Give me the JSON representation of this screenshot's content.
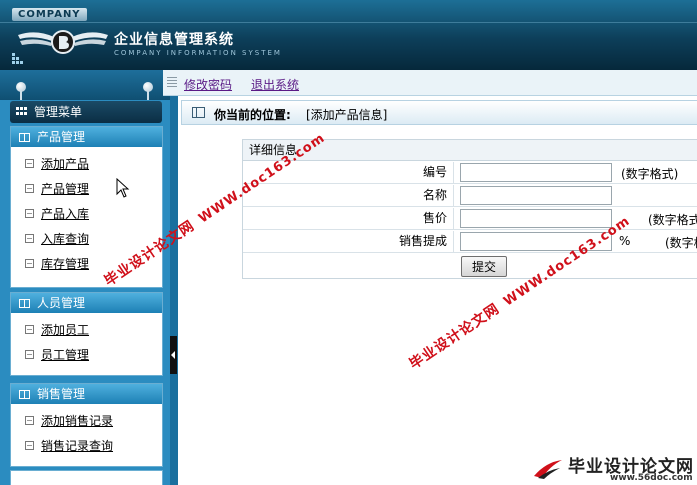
{
  "header": {
    "company_badge": "COMPANY",
    "title": "企业信息管理系统",
    "subtitle": "COMPANY INFORMATION SYSTEM"
  },
  "toolbar": {
    "change_password": "修改密码",
    "logout": "退出系统"
  },
  "sidebar": {
    "menu_title": "管理菜单",
    "panels": [
      {
        "title": "产品管理",
        "items": [
          "添加产品",
          "产品管理",
          "产品入库",
          "入库查询",
          "库存管理"
        ]
      },
      {
        "title": "人员管理",
        "items": [
          "添加员工",
          "员工管理"
        ]
      },
      {
        "title": "销售管理",
        "items": [
          "添加销售记录",
          "销售记录查询"
        ]
      }
    ]
  },
  "location": {
    "label": "你当前的位置:",
    "value": "[添加产品信息]"
  },
  "form": {
    "section_title": "详细信息",
    "fields": [
      {
        "label": "编号",
        "value": "",
        "hint": "(数字格式)"
      },
      {
        "label": "名称",
        "value": "",
        "hint": ""
      },
      {
        "label": "售价",
        "value": "",
        "hint": "(数字格式"
      },
      {
        "label": "销售提成",
        "value": "",
        "unit": "%",
        "hint": "(数字格"
      }
    ],
    "submit_label": "提交"
  },
  "watermark": {
    "site_name": "毕业设计论文网",
    "url": "WWW.doc163.com",
    "footer_name": "毕业设计论文网",
    "footer_url": "www.56doc.com",
    "color": "#d0101a"
  }
}
